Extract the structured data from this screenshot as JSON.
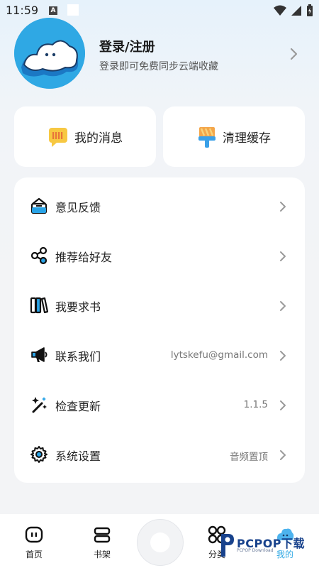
{
  "status_bar": {
    "time": "11:59",
    "notif_badge": "A"
  },
  "profile": {
    "title": "登录/注册",
    "subtitle": "登录即可免费同步云端收藏"
  },
  "quick_actions": [
    {
      "label": "我的消息",
      "icon": "message-icon"
    },
    {
      "label": "清理缓存",
      "icon": "broom-icon"
    }
  ],
  "menu": [
    {
      "label": "意见反馈",
      "value": "",
      "icon": "feedback-icon"
    },
    {
      "label": "推荐给好友",
      "value": "",
      "icon": "share-icon"
    },
    {
      "label": "我要求书",
      "value": "",
      "icon": "books-icon"
    },
    {
      "label": "联系我们",
      "value": "lytskefu@gmail.com",
      "icon": "megaphone-icon"
    },
    {
      "label": "检查更新",
      "value": "1.1.5",
      "icon": "magic-wand-icon"
    },
    {
      "label": "系统设置",
      "value": "音频置顶",
      "icon": "gear-icon"
    }
  ],
  "tabbar": {
    "tabs": [
      {
        "label": "首页",
        "icon": "home-icon"
      },
      {
        "label": "书架",
        "icon": "bookshelf-icon"
      },
      {
        "label": "分类",
        "icon": "category-icon"
      },
      {
        "label": "我的",
        "icon": "profile-icon"
      }
    ]
  },
  "watermark": {
    "text": "PCPOP下载",
    "sub": "PCPOP Download"
  },
  "colors": {
    "accent": "#2fa8e4",
    "page_bg": "#f3f4f6",
    "card_bg": "#ffffff"
  }
}
